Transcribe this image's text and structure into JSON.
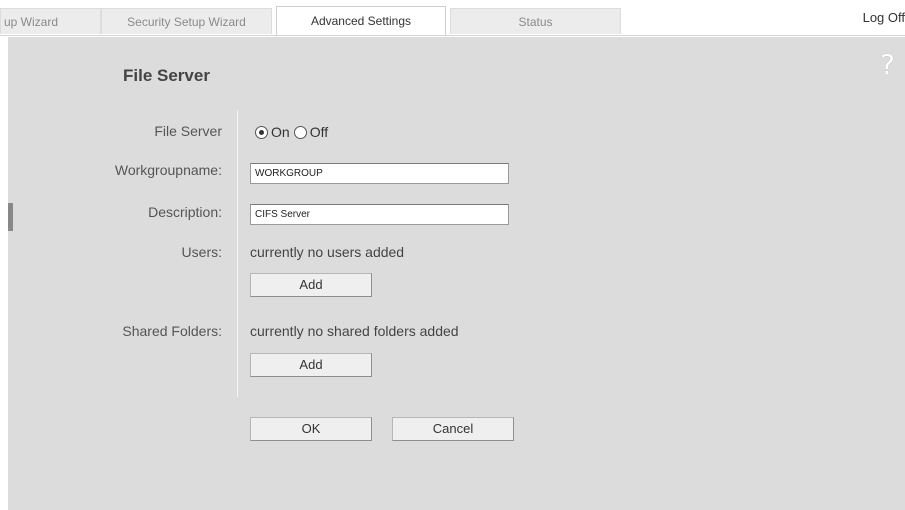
{
  "tabs": [
    {
      "label": "up Wizard",
      "active": false
    },
    {
      "label": "Security Setup Wizard",
      "active": false
    },
    {
      "label": "Advanced Settings",
      "active": true
    },
    {
      "label": "Status",
      "active": false
    }
  ],
  "header": {
    "logoff": "Log Off",
    "help": "?"
  },
  "section": {
    "title": "File Server"
  },
  "form": {
    "file_server": {
      "label": "File Server",
      "options": [
        "On",
        "Off"
      ],
      "selected": "On"
    },
    "workgroup": {
      "label": "Workgroupname:",
      "value": "WORKGROUP"
    },
    "description": {
      "label": "Description:",
      "value": "CIFS Server"
    },
    "users": {
      "label": "Users:",
      "status": "currently no users added",
      "add_label": "Add"
    },
    "shared_folders": {
      "label": "Shared Folders:",
      "status": "currently no shared folders added",
      "add_label": "Add"
    }
  },
  "buttons": {
    "ok": "OK",
    "cancel": "Cancel"
  },
  "colors": {
    "content_bg": "#dcdcdc",
    "tab_bg": "#ececec",
    "active_tab_bg": "#ffffff"
  }
}
